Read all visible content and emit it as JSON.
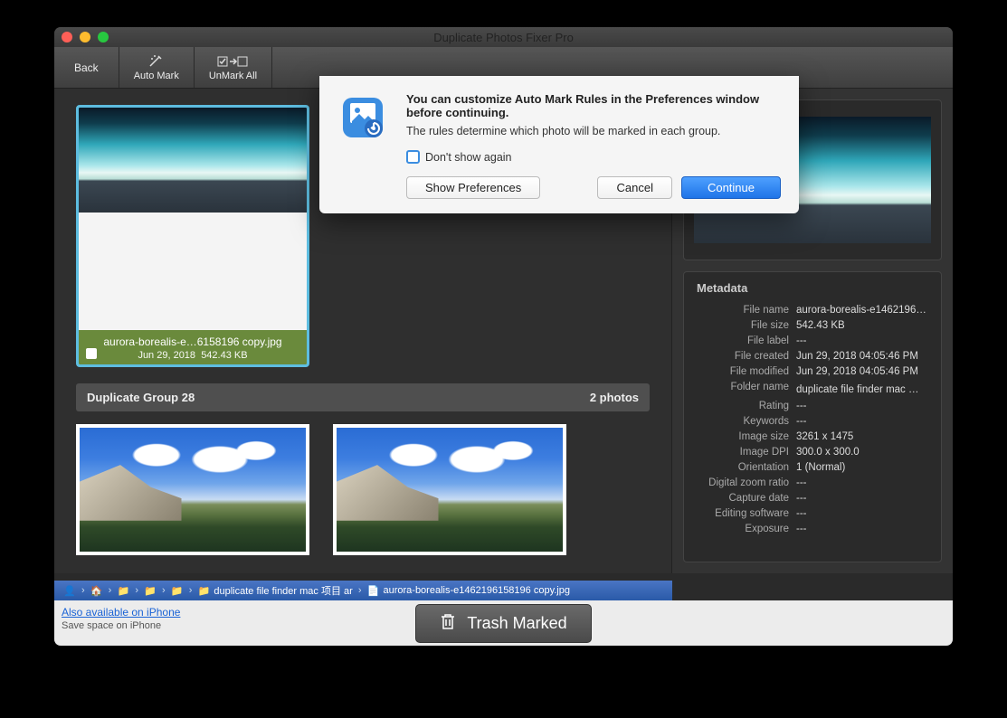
{
  "window": {
    "title": "Duplicate Photos Fixer Pro"
  },
  "toolbar": {
    "back": "Back",
    "automark": "Auto Mark",
    "unmarkall": "UnMark All"
  },
  "selected_thumb": {
    "filename": "aurora-borealis-e…6158196 copy.jpg",
    "date": "Jun 29, 2018",
    "size": "542.43 KB"
  },
  "group": {
    "title": "Duplicate Group 28",
    "count": "2 photos"
  },
  "metadata": {
    "heading": "Metadata",
    "rows": [
      {
        "label": "File name",
        "value": "aurora-borealis-e14621961…"
      },
      {
        "label": "File size",
        "value": "542.43 KB"
      },
      {
        "label": "File label",
        "value": "---"
      },
      {
        "label": "File created",
        "value": "Jun 29, 2018 04:05:46 PM"
      },
      {
        "label": "File modified",
        "value": "Jun 29, 2018 04:05:46 PM"
      },
      {
        "label": "Folder name",
        "value": "duplicate file finder mac 项…"
      },
      {
        "label": "Rating",
        "value": "---"
      },
      {
        "label": "Keywords",
        "value": "---"
      },
      {
        "label": "Image size",
        "value": "3261 x 1475"
      },
      {
        "label": "Image DPI",
        "value": "300.0 x 300.0"
      },
      {
        "label": "Orientation",
        "value": "1 (Normal)"
      },
      {
        "label": "Digital zoom ratio",
        "value": "---"
      },
      {
        "label": "Capture date",
        "value": "---"
      },
      {
        "label": "Editing software",
        "value": "---"
      },
      {
        "label": "Exposure",
        "value": "---"
      }
    ]
  },
  "path": {
    "folder": "duplicate file finder mac 项目 ar",
    "file": "aurora-borealis-e1462196158196 copy.jpg"
  },
  "footer": {
    "link": "Also available on iPhone",
    "sub": "Save space on iPhone",
    "trash": "Trash Marked"
  },
  "dialog": {
    "title": "You can customize Auto Mark Rules in the Preferences window before continuing.",
    "subtitle": "The rules determine which photo will be marked in each group.",
    "dontshow": "Don't show again",
    "show_prefs": "Show Preferences",
    "cancel": "Cancel",
    "continue": "Continue"
  }
}
